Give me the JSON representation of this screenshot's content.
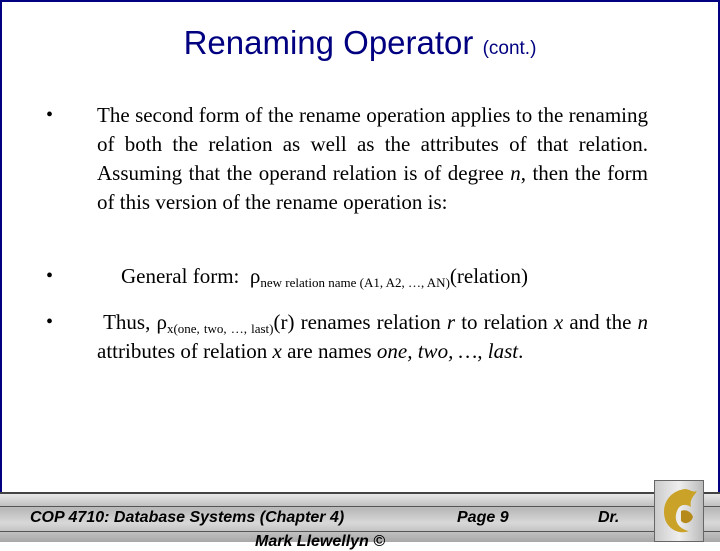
{
  "title": {
    "main": "Renaming Operator",
    "suffix": "(cont.)"
  },
  "bullets": [
    {
      "symbol": "•",
      "text": "The second form of the rename operation applies to the renaming of both the relation as well as the attributes of that relation.  Assuming that the operand relation is of degree ",
      "italic": "n",
      "text_end": ", then the form of this version of the rename operation is:"
    },
    {
      "symbol": "•",
      "prefix": "General form:  ",
      "rho": "ρ",
      "subscript": "new relation name (A1, A2, …, AN)",
      "suffix": "(relation)"
    },
    {
      "symbol": "•",
      "prefix": "Thus, ",
      "rho": "ρ",
      "subscript": "x(one, two, …, last)",
      "t1": "(r) renames relation ",
      "i1": "r",
      "t2": " to relation ",
      "i2": "x",
      "t3": " and the ",
      "i3": "n",
      "t4": " attributes of relation ",
      "i4": "x",
      "t5": " are names ",
      "i5": "one, two, …, last",
      "t6": "."
    }
  ],
  "footer": {
    "course": "COP 4710: Database Systems  (Chapter 4)",
    "page": "Page 9",
    "author": "Dr.",
    "author_cont": "Mark Llewellyn ©"
  },
  "logo": "UCF pegasus logo",
  "colors": {
    "title": "#000080",
    "border": "#000080"
  }
}
